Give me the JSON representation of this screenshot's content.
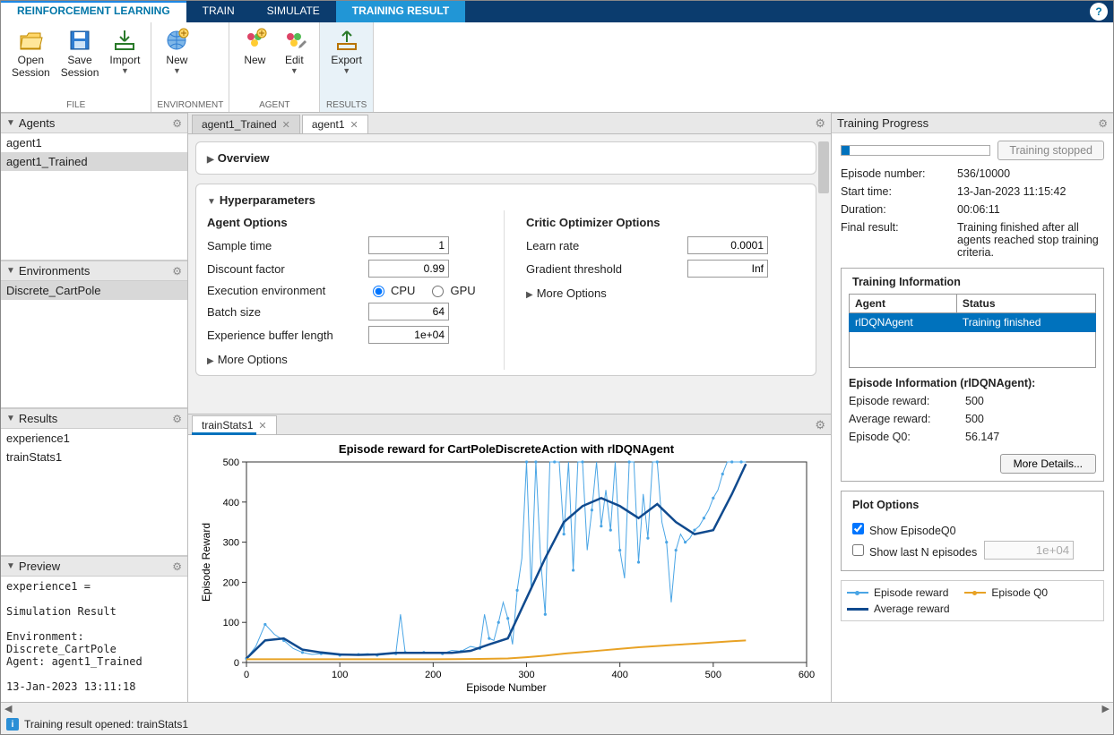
{
  "top_tabs": {
    "rl": "REINFORCEMENT LEARNING",
    "train": "TRAIN",
    "simulate": "SIMULATE",
    "result": "TRAINING RESULT"
  },
  "ribbon": {
    "file": {
      "open": "Open\nSession",
      "save": "Save\nSession",
      "import": "Import",
      "caption": "FILE"
    },
    "env": {
      "new": "New",
      "caption": "ENVIRONMENT"
    },
    "agent": {
      "new": "New",
      "edit": "Edit",
      "caption": "AGENT"
    },
    "results": {
      "export": "Export",
      "caption": "RESULTS"
    }
  },
  "left": {
    "agents": {
      "title": "Agents",
      "items": [
        "agent1",
        "agent1_Trained"
      ],
      "sel": 1
    },
    "envs": {
      "title": "Environments",
      "items": [
        "Discrete_CartPole"
      ],
      "sel": 0
    },
    "results": {
      "title": "Results",
      "items": [
        "experience1",
        "trainStats1"
      ]
    },
    "preview": {
      "title": "Preview",
      "text": "experience1 =\n\nSimulation Result\n\nEnvironment:\nDiscrete_CartPole\nAgent: agent1_Trained\n\n13-Jan-2023 13:11:18"
    }
  },
  "center": {
    "tabs": [
      "agent1_Trained",
      "agent1"
    ],
    "active_tab": 1,
    "overview_title": "Overview",
    "hyper_title": "Hyperparameters",
    "agent_opts": {
      "title": "Agent Options",
      "sample_time": {
        "label": "Sample time",
        "value": "1"
      },
      "discount": {
        "label": "Discount factor",
        "value": "0.99"
      },
      "exec_env": {
        "label": "Execution environment",
        "cpu": "CPU",
        "gpu": "GPU"
      },
      "batch": {
        "label": "Batch size",
        "value": "64"
      },
      "buf": {
        "label": "Experience buffer length",
        "value": "1e+04"
      },
      "more": "More Options"
    },
    "critic_opts": {
      "title": "Critic Optimizer Options",
      "learn": {
        "label": "Learn rate",
        "value": "0.0001"
      },
      "grad": {
        "label": "Gradient threshold",
        "value": "Inf"
      },
      "more": "More Options"
    },
    "chart_tab": "trainStats1"
  },
  "right": {
    "title": "Training Progress",
    "stopped": "Training stopped",
    "kvs": {
      "ep_num": {
        "k": "Episode number:",
        "v": "536/10000"
      },
      "start": {
        "k": "Start time:",
        "v": "13-Jan-2023 11:15:42"
      },
      "dur": {
        "k": "Duration:",
        "v": "00:06:11"
      },
      "final": {
        "k": "Final result:",
        "v": "Training finished after all agents reached stop training criteria."
      }
    },
    "ti": {
      "title": "Training Information",
      "cols": [
        "Agent",
        "Status"
      ],
      "row": [
        "rlDQNAgent",
        "Training finished"
      ]
    },
    "epi": {
      "title": "Episode Information (rlDQNAgent):",
      "reward": {
        "k": "Episode reward:",
        "v": "500"
      },
      "avg": {
        "k": "Average reward:",
        "v": "500"
      },
      "q0": {
        "k": "Episode Q0:",
        "v": "56.147"
      },
      "more": "More Details..."
    },
    "plot": {
      "title": "Plot Options",
      "show_q0": "Show EpisodeQ0",
      "show_n": "Show last N episodes",
      "n_val": "1e+04"
    },
    "legend": {
      "er": "Episode reward",
      "q0": "Episode Q0",
      "avg": "Average reward"
    }
  },
  "status": {
    "msg": "Training result opened: trainStats1"
  },
  "chart_data": {
    "type": "line",
    "title": "Episode reward for CartPoleDiscreteAction with rlDQNAgent",
    "xlabel": "Episode Number",
    "ylabel": "Episode Reward",
    "xlim": [
      0,
      600
    ],
    "ylim": [
      0,
      500
    ],
    "xticks": [
      0,
      100,
      200,
      300,
      400,
      500,
      600
    ],
    "yticks": [
      0,
      100,
      200,
      300,
      400,
      500
    ],
    "series": [
      {
        "name": "Episode reward",
        "color": "#4aa5e5",
        "marker": true,
        "x": [
          0,
          10,
          20,
          30,
          40,
          50,
          60,
          70,
          80,
          90,
          100,
          110,
          120,
          130,
          140,
          150,
          160,
          165,
          170,
          180,
          190,
          200,
          210,
          220,
          230,
          240,
          250,
          255,
          260,
          265,
          270,
          275,
          280,
          285,
          290,
          295,
          300,
          305,
          310,
          315,
          320,
          325,
          330,
          335,
          340,
          345,
          350,
          355,
          360,
          365,
          370,
          375,
          380,
          385,
          390,
          395,
          400,
          405,
          410,
          415,
          420,
          425,
          430,
          435,
          440,
          445,
          450,
          455,
          460,
          465,
          470,
          475,
          480,
          485,
          490,
          495,
          500,
          505,
          510,
          515,
          520,
          525,
          530,
          535
        ],
        "y": [
          10,
          40,
          95,
          70,
          55,
          35,
          25,
          20,
          22,
          20,
          18,
          18,
          20,
          22,
          18,
          20,
          22,
          120,
          25,
          23,
          25,
          23,
          22,
          30,
          28,
          40,
          35,
          120,
          60,
          55,
          100,
          150,
          110,
          45,
          180,
          260,
          500,
          180,
          500,
          260,
          120,
          500,
          500,
          500,
          320,
          500,
          230,
          500,
          500,
          280,
          380,
          500,
          340,
          430,
          330,
          500,
          280,
          210,
          500,
          500,
          250,
          420,
          310,
          500,
          500,
          350,
          300,
          150,
          280,
          320,
          300,
          310,
          330,
          340,
          360,
          380,
          410,
          430,
          470,
          500,
          500,
          500,
          500,
          500
        ]
      },
      {
        "name": "Average reward",
        "color": "#104a8e",
        "x": [
          0,
          20,
          40,
          60,
          80,
          100,
          120,
          140,
          160,
          180,
          200,
          220,
          240,
          260,
          280,
          300,
          320,
          340,
          360,
          380,
          400,
          420,
          440,
          460,
          480,
          500,
          520,
          535
        ],
        "y": [
          10,
          55,
          60,
          32,
          25,
          20,
          19,
          20,
          24,
          24,
          24,
          24,
          29,
          45,
          60,
          160,
          260,
          350,
          390,
          410,
          390,
          360,
          395,
          350,
          320,
          330,
          420,
          495
        ]
      },
      {
        "name": "Episode Q0",
        "color": "#e8a225",
        "x": [
          0,
          50,
          100,
          150,
          200,
          250,
          280,
          300,
          320,
          340,
          360,
          380,
          400,
          420,
          440,
          460,
          480,
          500,
          520,
          535
        ],
        "y": [
          8,
          8,
          8,
          8,
          8,
          9,
          10,
          13,
          17,
          22,
          26,
          30,
          34,
          38,
          41,
          44,
          47,
          50,
          53,
          55
        ]
      }
    ]
  }
}
